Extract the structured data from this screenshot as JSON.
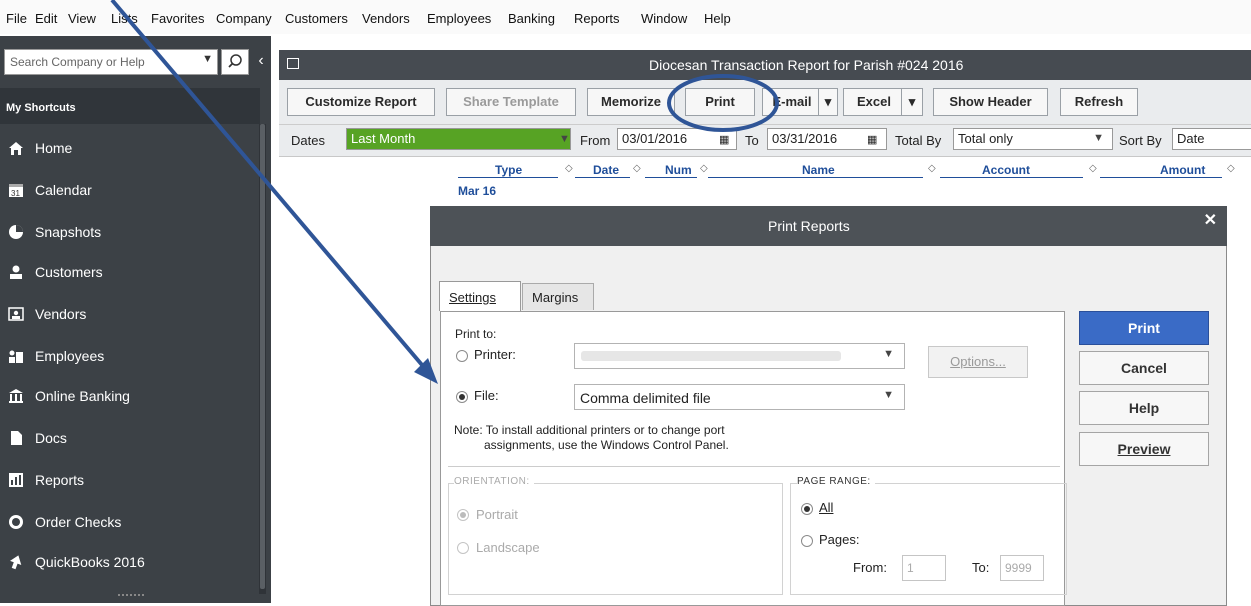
{
  "menu": [
    "File",
    "Edit",
    "View",
    "Lists",
    "Favorites",
    "Company",
    "Customers",
    "Vendors",
    "Employees",
    "Banking",
    "Reports",
    "Window",
    "Help"
  ],
  "search": {
    "placeholder": "Search Company or Help"
  },
  "sidebar": {
    "header": "My Shortcuts",
    "items": [
      {
        "label": "Home",
        "icon": "home-icon"
      },
      {
        "label": "Calendar",
        "icon": "calendar-icon"
      },
      {
        "label": "Snapshots",
        "icon": "snapshots-icon"
      },
      {
        "label": "Customers",
        "icon": "customers-icon"
      },
      {
        "label": "Vendors",
        "icon": "vendors-icon"
      },
      {
        "label": "Employees",
        "icon": "employees-icon"
      },
      {
        "label": "Online Banking",
        "icon": "bank-icon"
      },
      {
        "label": "Docs",
        "icon": "docs-icon"
      },
      {
        "label": "Reports",
        "icon": "reports-icon"
      },
      {
        "label": "Order Checks",
        "icon": "order-checks-icon"
      },
      {
        "label": "QuickBooks 2016",
        "icon": "quickbooks-icon"
      }
    ]
  },
  "report": {
    "title": "Diocesan Transaction Report for Parish #024 2016",
    "toolbar": {
      "customize": "Customize Report",
      "share": "Share Template",
      "memorize": "Memorize",
      "print": "Print",
      "email": "E-mail",
      "excel": "Excel",
      "show_header": "Show Header",
      "refresh": "Refresh"
    },
    "filters": {
      "dates_label": "Dates",
      "dates_value": "Last Month",
      "from_label": "From",
      "from_value": "03/01/2016",
      "to_label": "To",
      "to_value": "03/31/2016",
      "total_by_label": "Total By",
      "total_by_value": "Total only",
      "sort_by_label": "Sort By",
      "sort_by_value": "Date"
    },
    "columns": [
      "Type",
      "Date",
      "Num",
      "Name",
      "Account",
      "Amount"
    ],
    "group_label": "Mar 16"
  },
  "dialog": {
    "title": "Print Reports",
    "tabs": [
      "Settings",
      "Margins"
    ],
    "print_to_label": "Print to:",
    "printer_label": "Printer:",
    "file_label": "File:",
    "file_value": "Comma delimited file",
    "options_label": "Options...",
    "note_line1": "Note: To install additional printers or to change port",
    "note_line2": "assignments, use the Windows Control Panel.",
    "orientation_title": "ORIENTATION:",
    "portrait_label": "Portrait",
    "landscape_label": "Landscape",
    "range_title": "PAGE RANGE:",
    "all_label": "All",
    "pages_label": "Pages:",
    "from_label": "From:",
    "from_value": "1",
    "to_label": "To:",
    "to_value": "9999",
    "buttons": {
      "print": "Print",
      "cancel": "Cancel",
      "help": "Help",
      "preview": "Preview"
    }
  },
  "colors": {
    "sidebar": "#3c4146",
    "dates_highlight": "#57a324",
    "primary_button": "#3a6bc6",
    "annotation": "#2f5597"
  }
}
